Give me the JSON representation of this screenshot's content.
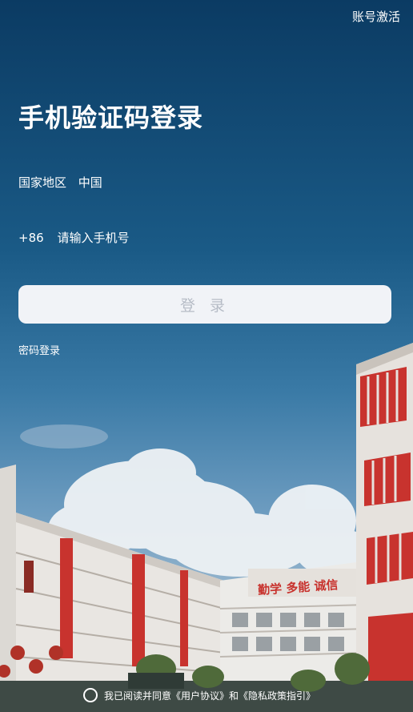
{
  "header": {
    "activate_label": "账号激活"
  },
  "main": {
    "title": "手机验证码登录",
    "region_label": "国家地区",
    "region_value": "中国",
    "phone_code": "+86",
    "phone_placeholder": "请输入手机号",
    "login_button": "登 录",
    "password_login": "密码登录"
  },
  "footer": {
    "agreement_prefix": "我已阅读并同意",
    "user_agreement": "《用户协议》",
    "and": "和",
    "privacy_policy": "《隐私政策指引》"
  },
  "signage": {
    "banner_text": "勤学 多能 诚信"
  },
  "colors": {
    "sky_top": "#0b3b63",
    "button_bg": "#f1f3f7",
    "button_text": "#b6bcc6",
    "building_wall": "#e9e6e2",
    "building_red": "#c8332e"
  },
  "icons": {
    "agree_radio": "radio-unchecked-icon"
  }
}
